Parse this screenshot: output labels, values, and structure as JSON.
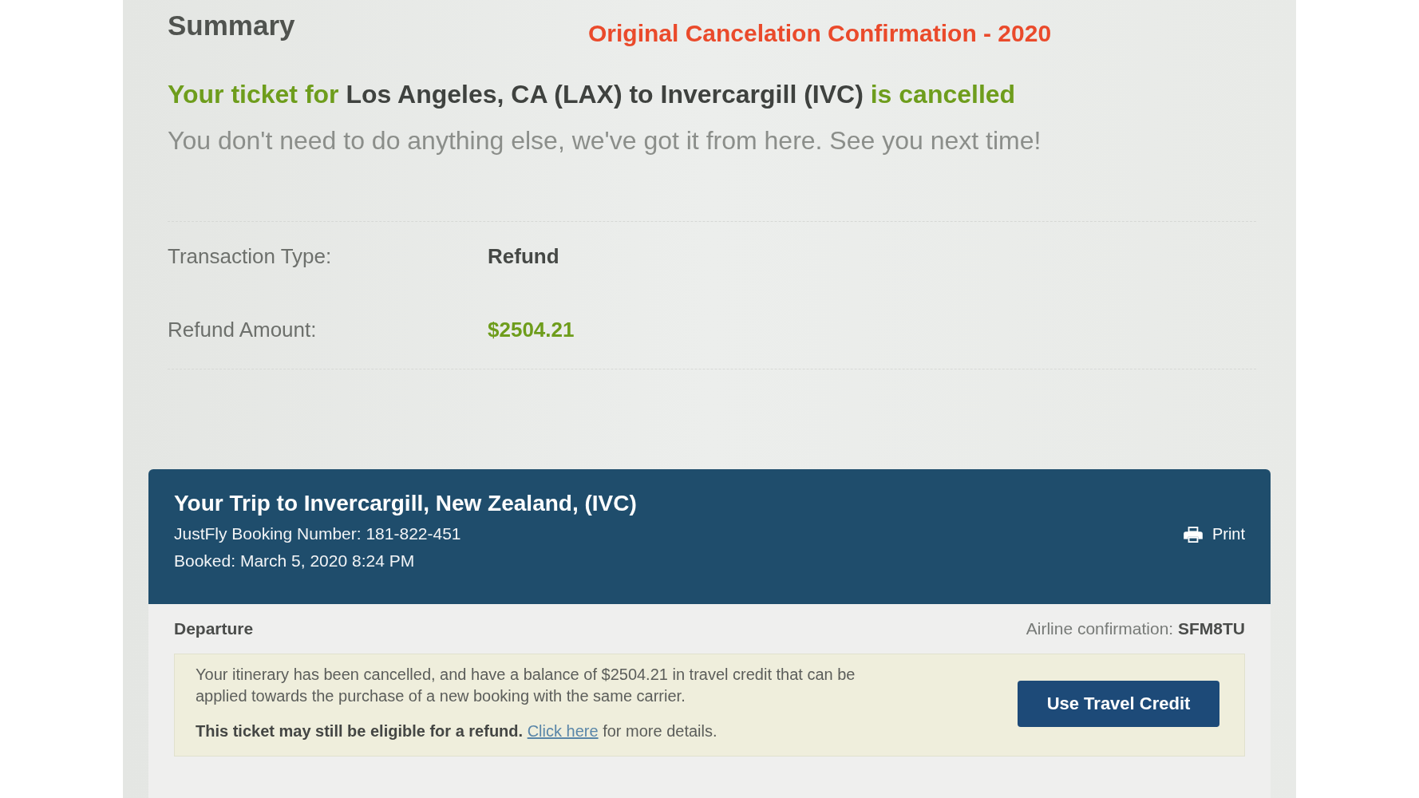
{
  "summary": {
    "title": "Summary",
    "annotation": "Original Cancelation Confirmation - 2020",
    "headline": {
      "lead": "Your ticket for",
      "route": "Los Angeles, CA (LAX) to Invercargill (IVC)",
      "status": "is cancelled"
    },
    "message": "You don't need to do anything else, we've got it from here. See you next time!",
    "details": [
      {
        "label": "Transaction Type:",
        "value": "Refund",
        "kind": "text"
      },
      {
        "label": "Refund Amount:",
        "value": "$2504.21",
        "kind": "amount"
      }
    ]
  },
  "trip": {
    "title": "Your Trip to Invercargill, New Zealand, (IVC)",
    "booking_number": "JustFly Booking Number: 181-822-451",
    "booked": "Booked: March 5, 2020 8:24 PM",
    "print_label": "Print"
  },
  "departure": {
    "heading": "Departure",
    "confirmation_label": "Airline confirmation:",
    "confirmation_code": "SFM8TU",
    "notice": {
      "message": "Your itinerary has been cancelled, and have a balance of $2504.21 in travel credit that can be applied towards the purchase of a new booking with the same carrier.",
      "refund_note": "This ticket may still be eligible for a refund.",
      "link": "Click here",
      "link_tail": "for more details.",
      "button": "Use Travel Credit"
    }
  }
}
